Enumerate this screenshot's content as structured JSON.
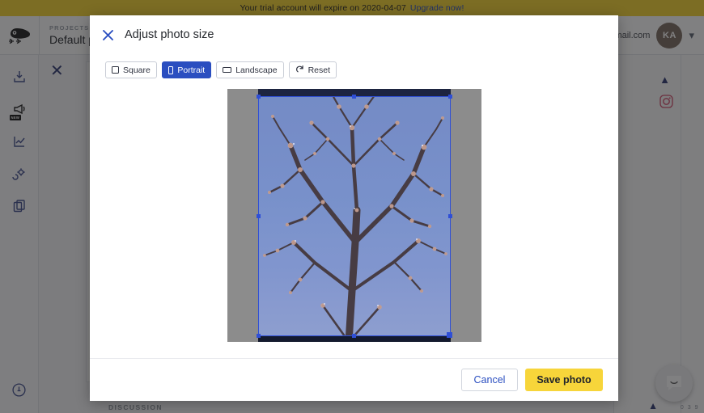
{
  "banner": {
    "message": "Your trial account will expire on 2020-04-07",
    "upgrade_label": "Upgrade now!",
    "bg_color": "#f6d32d"
  },
  "header": {
    "logo_icon": "cat-logo-icon",
    "project_kicker": "PROJECTS",
    "project_name": "Default p",
    "user_email": "gmail.com",
    "avatar_initials": "KA",
    "caret_icon": "chevron-down-icon"
  },
  "sidebar": {
    "items": [
      {
        "icon": "inbox-download-icon",
        "name": "sidebar-item-import"
      },
      {
        "icon": "megaphone-icon",
        "name": "sidebar-item-announcements",
        "badge": "NEW"
      },
      {
        "icon": "analytics-chart-icon",
        "name": "sidebar-item-analytics"
      },
      {
        "icon": "settings-gear-icon",
        "name": "sidebar-item-settings"
      },
      {
        "icon": "copy-duplicate-icon",
        "name": "sidebar-item-library"
      }
    ],
    "bottom_item": {
      "icon": "info-circle-icon",
      "name": "sidebar-item-info"
    }
  },
  "background_page": {
    "close_icon": "close-icon",
    "discussion_label": "DISCUSSION",
    "instagram_icon": "instagram-icon",
    "collapse_icon": "chevron-up-icon",
    "counter": "0 3 9",
    "chat_icon": "chat-bubble-icon"
  },
  "modal": {
    "close_icon": "close-icon",
    "title": "Adjust photo size",
    "ratio_buttons": [
      {
        "label": "Square",
        "icon": "square-ratio-icon",
        "active": false
      },
      {
        "label": "Portrait",
        "icon": "portrait-ratio-icon",
        "active": true
      },
      {
        "label": "Landscape",
        "icon": "landscape-ratio-icon",
        "active": false
      },
      {
        "label": "Reset",
        "icon": "reset-rotate-icon",
        "active": false
      }
    ],
    "photo_alt": "blossoming tree against blue sky",
    "cancel_label": "Cancel",
    "save_label": "Save photo",
    "accent_color": "#2a4ec0",
    "save_color": "#f7d53a"
  }
}
